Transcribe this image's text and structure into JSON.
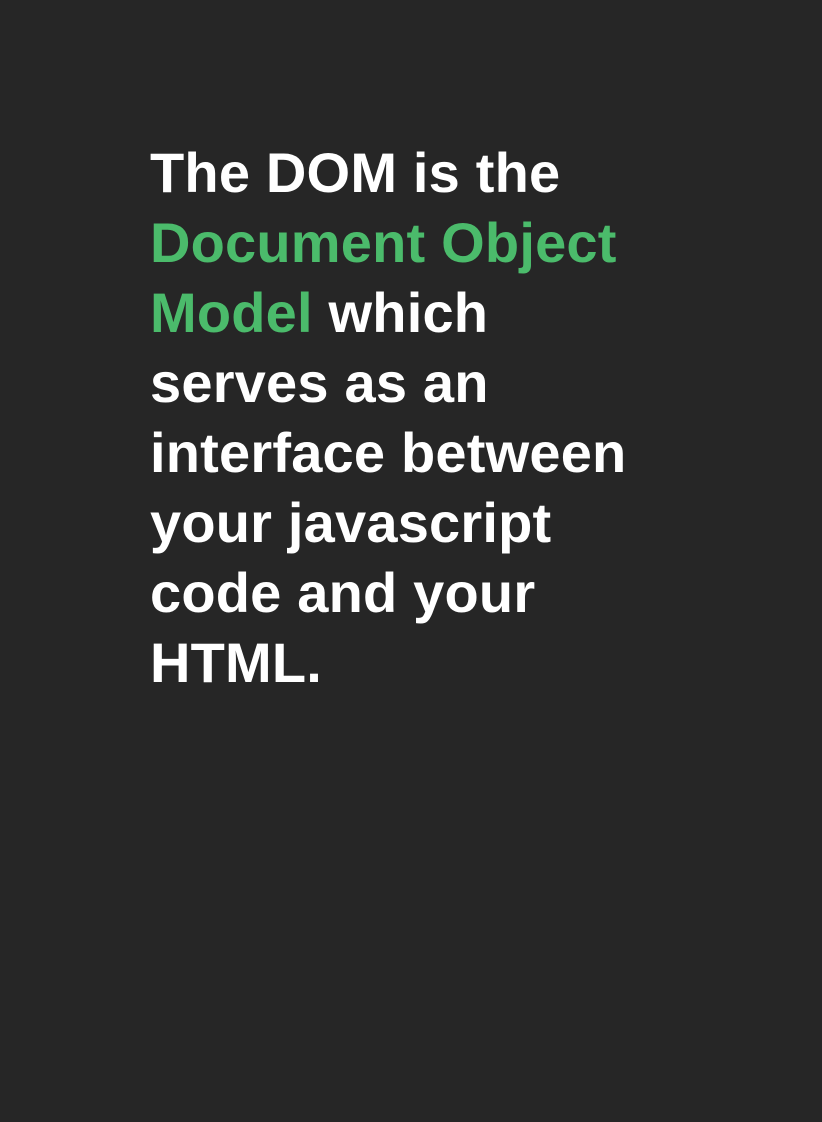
{
  "colors": {
    "background": "#262626",
    "text": "#ffffff",
    "highlight": "#4bbb6b"
  },
  "quote": {
    "line1": "The DOM is the",
    "line2": "Document Object",
    "line3_highlight": "Model",
    "line3_rest": " which",
    "line4": "serves as an",
    "line5": "interface between",
    "line6": "your javascript",
    "line7": "code and your",
    "line8": "HTML."
  }
}
